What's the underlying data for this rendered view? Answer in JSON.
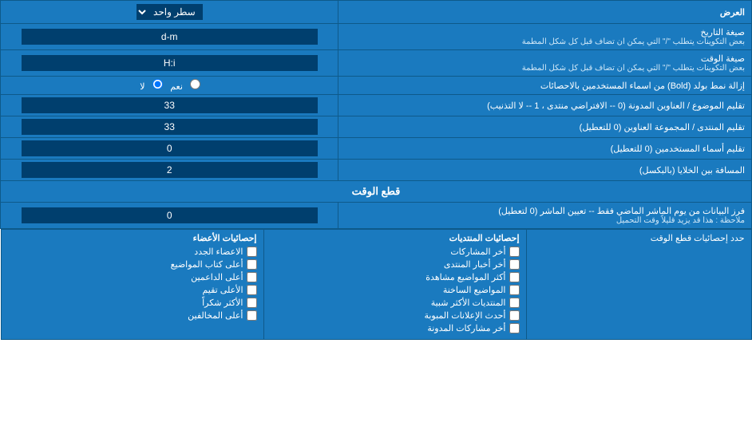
{
  "header": {
    "label_right": "العرض",
    "label_left": "سطر واحد"
  },
  "rows": [
    {
      "id": "date-format",
      "label": "صيغة التاريخ",
      "sublabel": "بعض التكوينات يتطلب \"/\" التي يمكن ان تضاف قبل كل شكل المطمة",
      "value": "d-m",
      "type": "text"
    },
    {
      "id": "time-format",
      "label": "صيغة الوقت",
      "sublabel": "بعض التكوينات يتطلب \"/\" التي يمكن ان تضاف قبل كل شكل المطمة",
      "value": "H:i",
      "type": "text"
    },
    {
      "id": "bold-remove",
      "label": "إزالة نمط بولد (Bold) من اسماء المستخدمين بالاحصائات",
      "value_yes": "نعم",
      "value_no": "لا",
      "type": "radio",
      "selected": "no"
    },
    {
      "id": "topic-titles",
      "label": "تقليم الموضوع / العناوين المدونة (0 -- الافتراضي منتدى ، 1 -- لا التذنيب)",
      "value": "33",
      "type": "text"
    },
    {
      "id": "forum-titles",
      "label": "تقليم المنتدى / المجموعة العناوين (0 للتعطيل)",
      "value": "33",
      "type": "text"
    },
    {
      "id": "usernames",
      "label": "تقليم أسماء المستخدمين (0 للتعطيل)",
      "value": "0",
      "type": "text"
    },
    {
      "id": "space-between",
      "label": "المسافة بين الخلايا (بالبكسل)",
      "value": "2",
      "type": "text"
    }
  ],
  "section_cutoff": {
    "title": "قطع الوقت",
    "row": {
      "id": "cutoff-days",
      "label": "فرز البيانات من يوم الماشر الماضي فقط -- تعيين الماشر (0 لتعطيل)",
      "sublabel": "ملاحظة : هذا قد يزيد قليلاً وقت التحميل",
      "value": "0",
      "type": "text"
    }
  },
  "bottom_section": {
    "label": "حدد إحصائيات قطع الوقت",
    "col1_header": "إحصائيات المنتديات",
    "col2_header": "إحصائيات الأعضاء",
    "col1_items": [
      "أخر المشاركات",
      "أخر أخبار المنتدى",
      "أكثر المواضيع مشاهدة",
      "المواضيع الساخنة",
      "المنتديات الأكثر شبية",
      "أحدث الإعلانات المبوبة",
      "أخر مشاركات المدونة"
    ],
    "col2_items": [
      "الاعضاء الجدد",
      "أعلى كتاب المواضيع",
      "أعلى الداعمين",
      "الأعلى تقيم",
      "الأكثر شكراً",
      "أعلى المخالفين"
    ]
  },
  "dropdown_option": "سطر واحد",
  "icons": {
    "dropdown": "▼",
    "checked": "☑",
    "unchecked": "☐"
  }
}
